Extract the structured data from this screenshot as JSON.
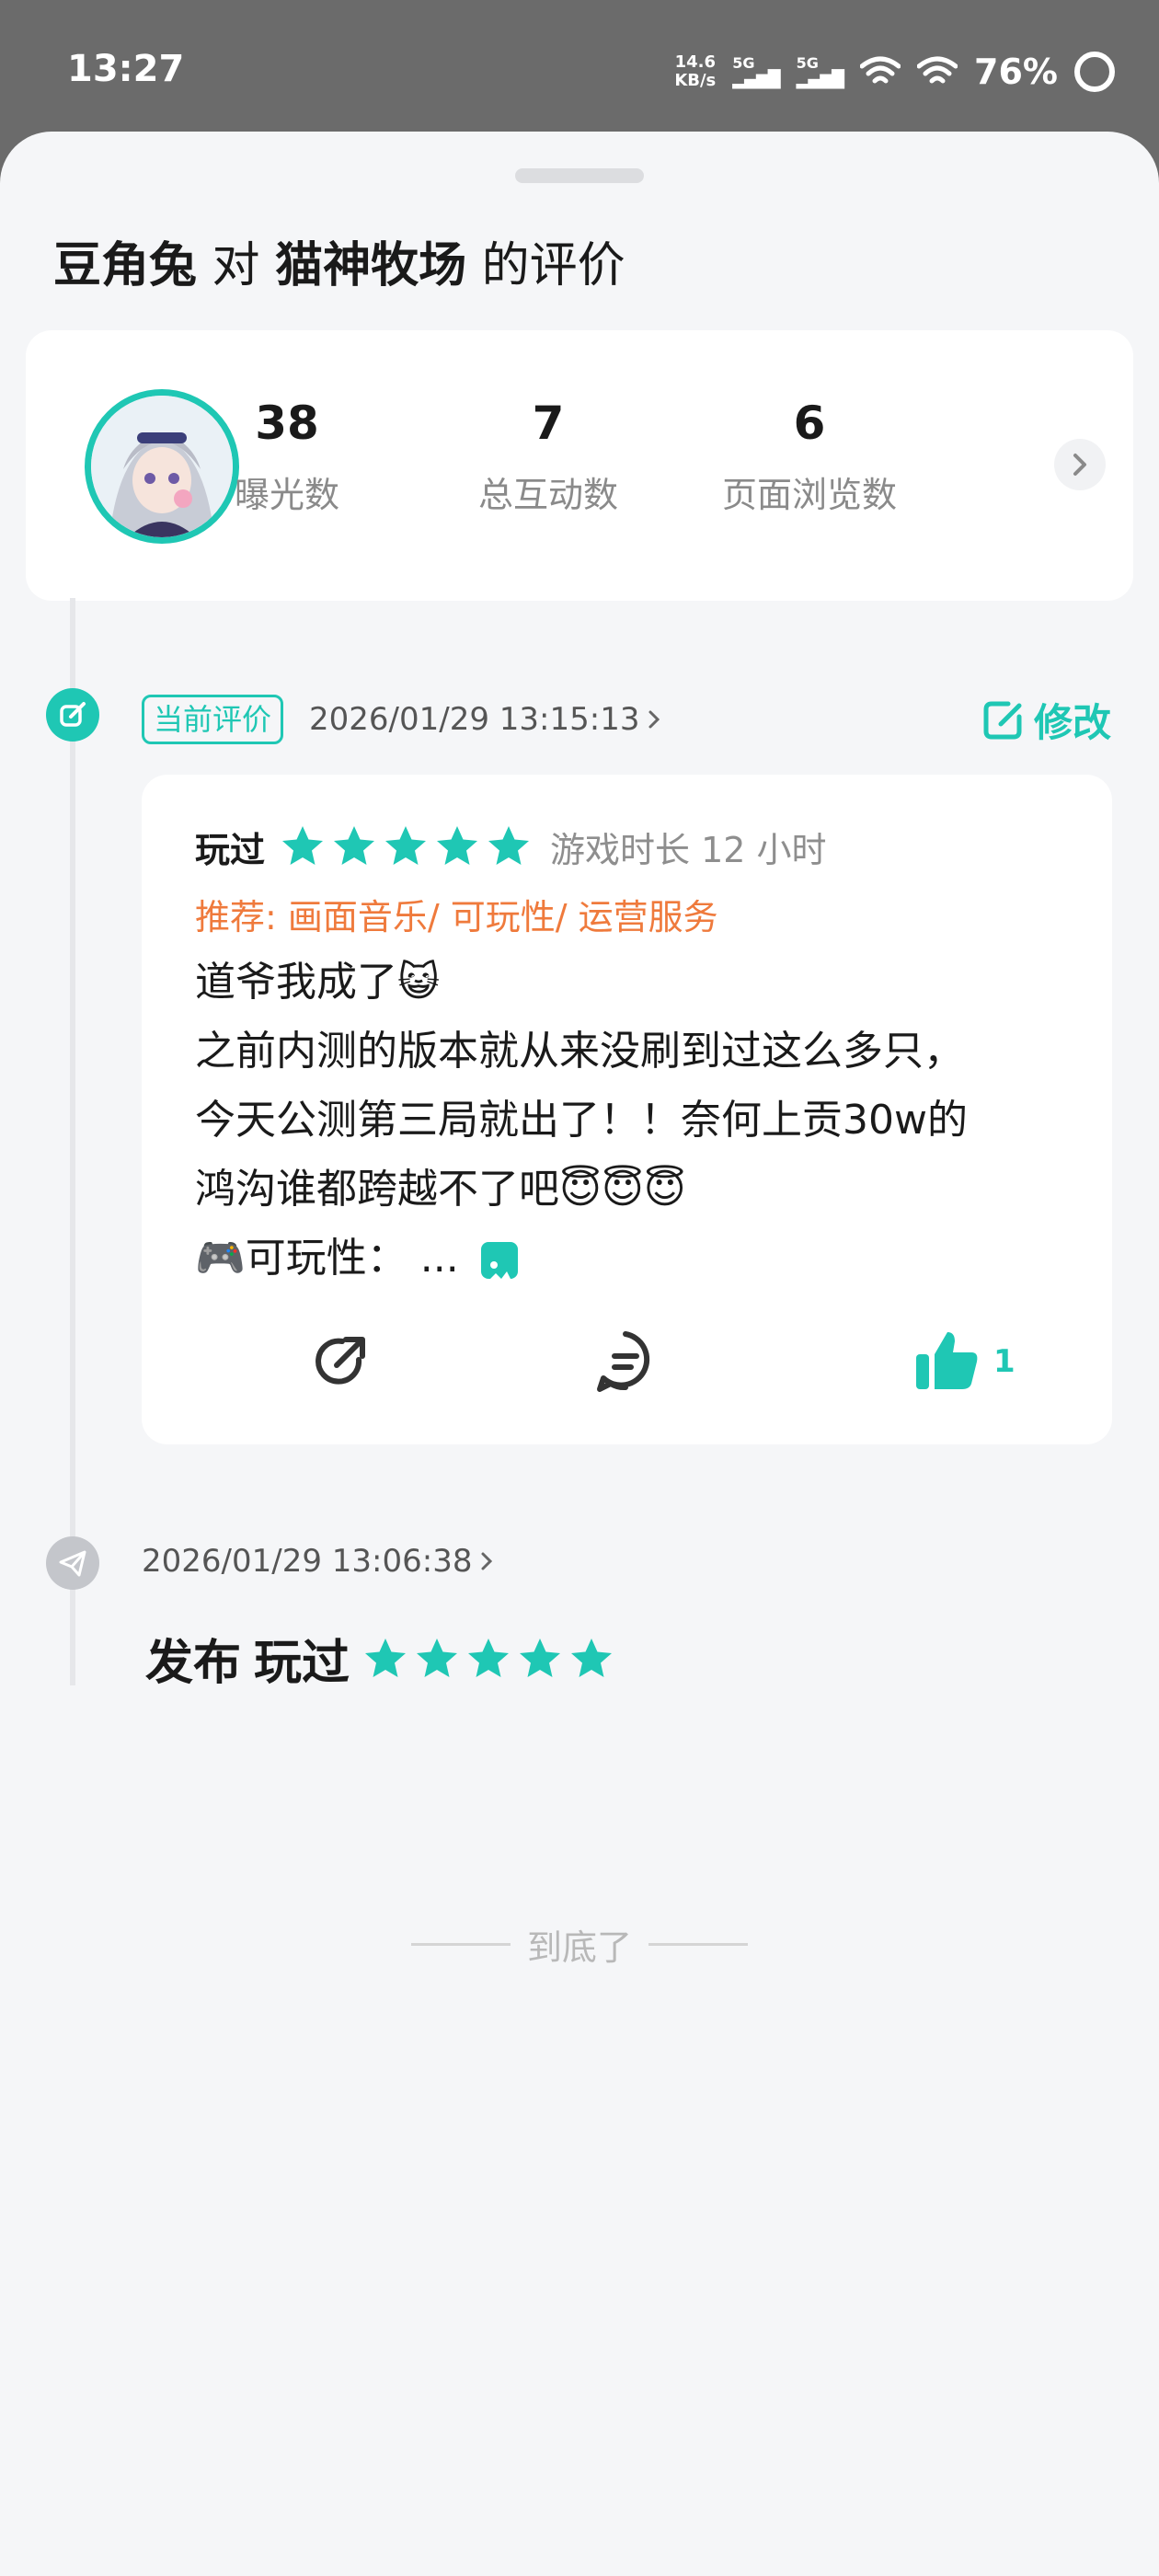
{
  "status_bar": {
    "time": "13:27",
    "net_speed_value": "14.6",
    "net_speed_unit": "KB/s",
    "signal_1_label": "5G",
    "signal_2_label": "5G",
    "battery": "76%"
  },
  "header": {
    "user_name": "豆角兔",
    "connector": "对",
    "game_name": "猫神牧场",
    "suffix": "的评价"
  },
  "stats": [
    {
      "value": "38",
      "label": "曝光数"
    },
    {
      "value": "7",
      "label": "总互动数"
    },
    {
      "value": "6",
      "label": "页面浏览数"
    }
  ],
  "current_review": {
    "badge": "当前评价",
    "timestamp": "2026/01/29 13:15:13",
    "edit_label": "修改",
    "status": "玩过",
    "stars": 5,
    "playtime": "游戏时长 12 小时",
    "recommend": "推荐: 画面音乐/ 可玩性/ 运营服务",
    "body_lines": [
      "道爷我成了😺",
      "之前内测的版本就从来没刷到过这么多只，",
      "今天公测第三局就出了！！奈何上贡30w的",
      "鸿沟谁都跨越不了吧😇😇😇",
      "🎮可玩性：  ..."
    ],
    "like_count": "1"
  },
  "publish_event": {
    "timestamp": "2026/01/29 13:06:38",
    "action": "发布",
    "status": "玩过",
    "stars": 5
  },
  "footer": {
    "end_text": "到底了"
  },
  "colors": {
    "accent": "#1fc7b4",
    "recommend": "#ef7a3c",
    "background": "#f5f6f8"
  }
}
